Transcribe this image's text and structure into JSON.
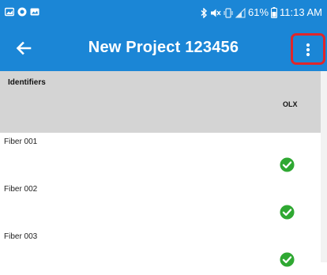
{
  "status_bar": {
    "left_icons": [
      "gallery-icon",
      "circle-badge-icon",
      "photo-icon"
    ],
    "right_icons": [
      "bluetooth-icon",
      "mute-icon",
      "vibrate-icon",
      "signal-icon",
      "battery-icon"
    ],
    "battery": "61%",
    "time": "11:13 AM"
  },
  "app_bar": {
    "title": "New Project 123456",
    "back_icon": "arrow-left-icon",
    "menu_icon": "more-vertical-icon",
    "highlight_color": "#e0262a"
  },
  "table": {
    "columns": [
      {
        "label": "Identifiers"
      },
      {
        "label": "OLX"
      }
    ],
    "rows": [
      {
        "identifier": "Fiber 001",
        "olx_status": "pass"
      },
      {
        "identifier": "Fiber 002",
        "olx_status": "pass"
      },
      {
        "identifier": "Fiber 003",
        "olx_status": "pass"
      }
    ]
  },
  "colors": {
    "app_bar": "#1b86d6",
    "header_band": "#d4d4d4",
    "pass": "#2fa832"
  }
}
